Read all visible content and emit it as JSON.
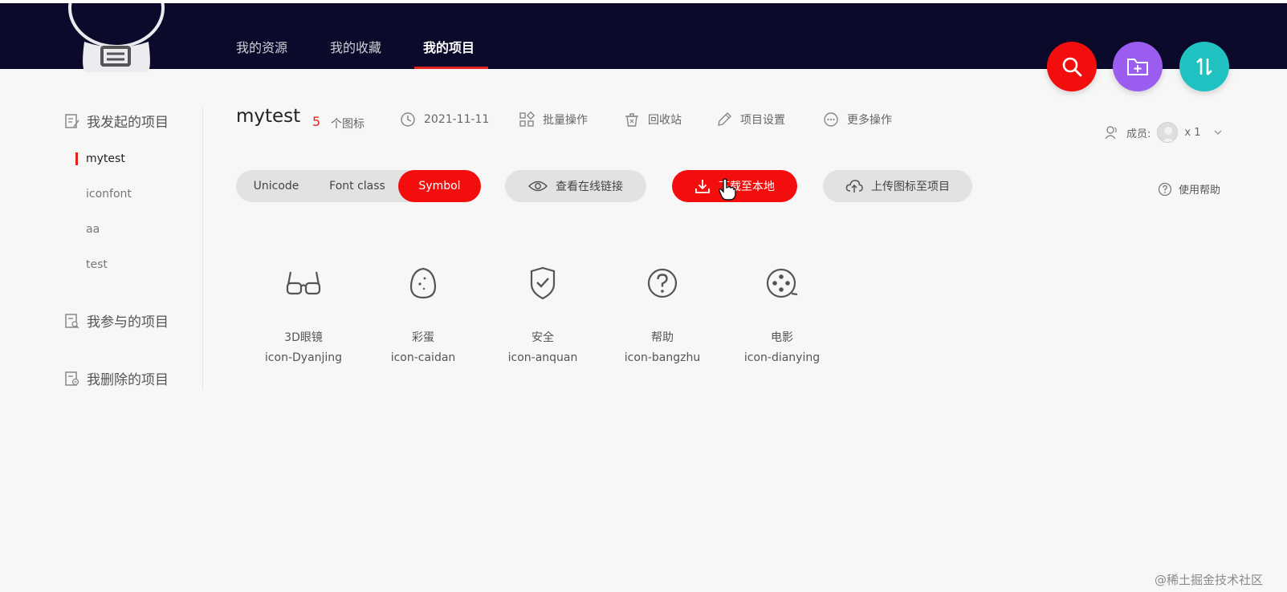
{
  "header": {
    "nav": [
      {
        "label": "我的资源"
      },
      {
        "label": "我的收藏"
      },
      {
        "label": "我的项目"
      }
    ],
    "active_nav": "我的项目",
    "fab_colors": [
      "#f40d0d",
      "#9b5cf0",
      "#1fc1c1"
    ],
    "fab_icons": [
      "search-icon",
      "add-folder-icon",
      "sort-icon"
    ]
  },
  "sidebar": {
    "started_label": "我发起的项目",
    "projects": [
      {
        "label": "mytest",
        "active": true
      },
      {
        "label": "iconfont"
      },
      {
        "label": "aa"
      },
      {
        "label": "test"
      }
    ],
    "joined_label": "我参与的项目",
    "deleted_label": "我删除的项目"
  },
  "project": {
    "name": "mytest",
    "icon_count": "5",
    "icon_count_label": "个图标",
    "date": "2021-11-11",
    "batch_label": "批量操作",
    "recycle_label": "回收站",
    "settings_label": "项目设置",
    "more_label": "更多操作",
    "members_label": "成员:",
    "members_count": "x 1"
  },
  "toolbar": {
    "tabs": [
      "Unicode",
      "Font class",
      "Symbol"
    ],
    "active_tab": "Symbol",
    "view_link_label": "查看在线链接",
    "download_label": "下载至本地",
    "upload_label": "上传图标至项目",
    "help_label": "使用帮助"
  },
  "icons": [
    {
      "name": "3D眼镜",
      "code": "icon-Dyanjing",
      "icon": "3d-glasses-icon"
    },
    {
      "name": "彩蛋",
      "code": "icon-caidan",
      "icon": "egg-icon"
    },
    {
      "name": "安全",
      "code": "icon-anquan",
      "icon": "shield-icon"
    },
    {
      "name": "帮助",
      "code": "icon-bangzhu",
      "icon": "help-icon"
    },
    {
      "name": "电影",
      "code": "icon-dianying",
      "icon": "film-reel-icon"
    }
  ],
  "watermark": "@稀土掘金技术社区",
  "colors": {
    "accent": "#f40d0d",
    "header_bg": "#0b0a2a"
  }
}
